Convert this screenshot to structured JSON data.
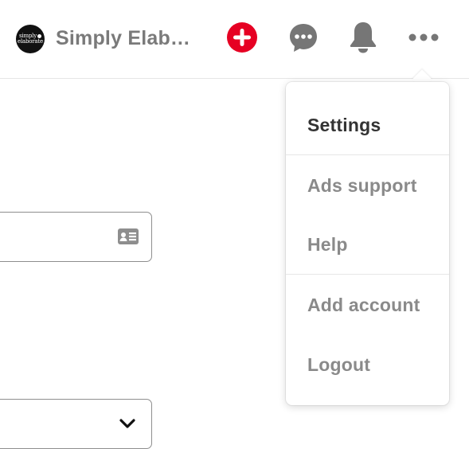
{
  "header": {
    "avatar_text_line1": "simply",
    "avatar_text_line2": "elaborate",
    "account_name": "Simply Elab…",
    "icons": [
      "plus-circle-icon",
      "speech-bubble-icon",
      "bell-icon",
      "ellipsis-icon"
    ]
  },
  "colors": {
    "create_red": "#e60023",
    "icon_gray": "#767676",
    "text_active": "#333333",
    "text_muted": "#8a8a8a"
  },
  "menu": {
    "items": [
      {
        "label": "Settings"
      },
      {
        "label": "Ads support"
      },
      {
        "label": "Help"
      },
      {
        "label": "Add account"
      },
      {
        "label": "Logout"
      }
    ]
  },
  "form": {
    "field_icons": [
      "id-card-icon",
      "chevron-down-icon"
    ]
  }
}
